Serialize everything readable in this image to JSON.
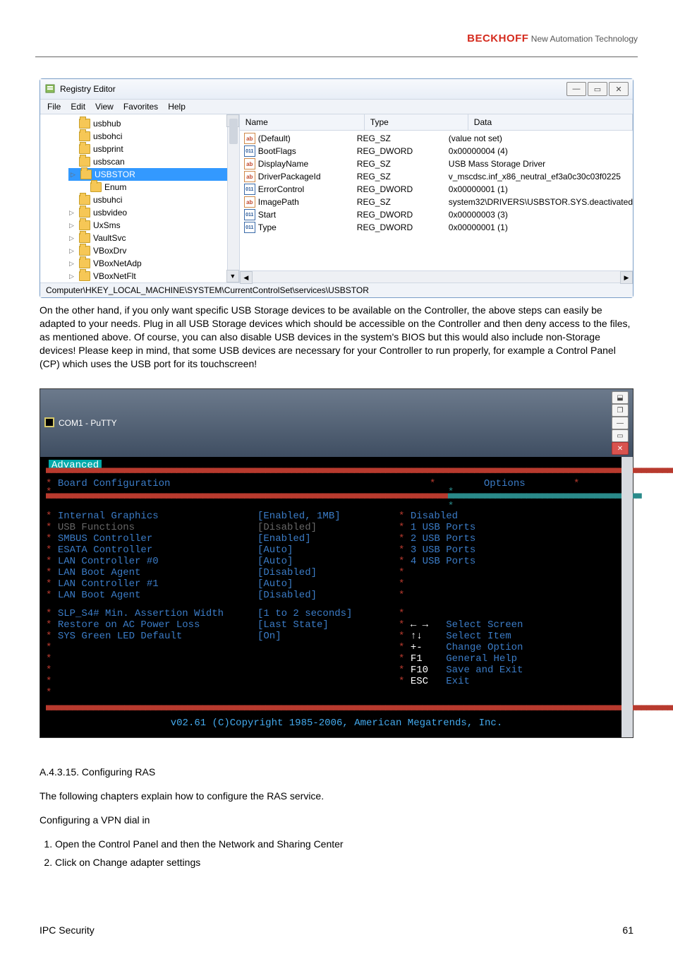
{
  "header": {
    "brand_bold": "BECKHOFF",
    "brand_rest": " New Automation Technology"
  },
  "regedit": {
    "title": "Registry Editor",
    "menus": [
      "File",
      "Edit",
      "View",
      "Favorites",
      "Help"
    ],
    "tree": [
      "usbhub",
      "usbohci",
      "usbprint",
      "usbscan",
      "USBSTOR",
      "Enum",
      "usbuhci",
      "usbvideo",
      "UxSms",
      "VaultSvc",
      "VBoxDrv",
      "VBoxNetAdp",
      "VBoxNetFlt"
    ],
    "selected_index": 4,
    "columns": [
      "Name",
      "Type",
      "Data"
    ],
    "values": [
      {
        "icon": "str",
        "name": "(Default)",
        "type": "REG_SZ",
        "data": "(value not set)"
      },
      {
        "icon": "dw",
        "name": "BootFlags",
        "type": "REG_DWORD",
        "data": "0x00000004 (4)"
      },
      {
        "icon": "str",
        "name": "DisplayName",
        "type": "REG_SZ",
        "data": "USB Mass Storage Driver"
      },
      {
        "icon": "str",
        "name": "DriverPackageId",
        "type": "REG_SZ",
        "data": "v_mscdsc.inf_x86_neutral_ef3a0c30c03f0225"
      },
      {
        "icon": "dw",
        "name": "ErrorControl",
        "type": "REG_DWORD",
        "data": "0x00000001 (1)"
      },
      {
        "icon": "str",
        "name": "ImagePath",
        "type": "REG_SZ",
        "data": "system32\\DRIVERS\\USBSTOR.SYS.deactivated"
      },
      {
        "icon": "dw",
        "name": "Start",
        "type": "REG_DWORD",
        "data": "0x00000003 (3)"
      },
      {
        "icon": "dw",
        "name": "Type",
        "type": "REG_DWORD",
        "data": "0x00000001 (1)"
      }
    ],
    "status": "Computer\\HKEY_LOCAL_MACHINE\\SYSTEM\\CurrentControlSet\\services\\USBSTOR"
  },
  "paragraph1": "On the other hand, if you only want specific USB Storage devices to be available on the Controller, the above steps can easily be adapted to your needs. Plug in all USB Storage devices which should be accessible on the Controller and then deny access to the files, as mentioned above. Of course, you can also disable USB devices in the system's BIOS but this would also include non-Storage devices! Please keep in mind, that some USB devices are necessary for your Controller to run properly, for example a Control Panel (CP) which uses the USB port for its touchscreen!",
  "bios": {
    "window_title": "COM1 - PuTTY",
    "tab_label": "Advanced",
    "section_title": "Board Configuration",
    "options_label": "Options",
    "left_items": [
      {
        "label": "Internal Graphics",
        "val": "[Enabled, 1MB]",
        "lcls": "c-blue",
        "vcls": "c-blue"
      },
      {
        "label": "USB Functions",
        "val": "[Disabled]",
        "lcls": "c-grey",
        "vcls": "c-grey"
      },
      {
        "label": "SMBUS Controller",
        "val": "[Enabled]",
        "lcls": "c-blue",
        "vcls": "c-blue"
      },
      {
        "label": "ESATA Controller",
        "val": "[Auto]",
        "lcls": "c-blue",
        "vcls": "c-blue"
      },
      {
        "label": "LAN Controller #0",
        "val": "[Auto]",
        "lcls": "c-blue",
        "vcls": "c-blue"
      },
      {
        "label": "  LAN Boot Agent",
        "val": "[Disabled]",
        "lcls": "c-blue",
        "vcls": "c-blue"
      },
      {
        "label": "LAN Controller #1",
        "val": "[Auto]",
        "lcls": "c-blue",
        "vcls": "c-blue"
      },
      {
        "label": "  LAN Boot Agent",
        "val": "[Disabled]",
        "lcls": "c-blue",
        "vcls": "c-blue"
      }
    ],
    "left_items2": [
      {
        "label": "SLP_S4# Min. Assertion Width",
        "val": "[1 to 2 seconds]",
        "lcls": "c-blue",
        "vcls": "c-blue"
      },
      {
        "label": "Restore on AC Power Loss",
        "val": "[Last State]",
        "lcls": "c-blue",
        "vcls": "c-blue"
      },
      {
        "label": "SYS Green LED Default",
        "val": "[On]",
        "lcls": "c-blue",
        "vcls": "c-blue"
      }
    ],
    "right_options": [
      "Disabled",
      "1 USB Ports",
      "2 USB Ports",
      "3 USB Ports",
      "4 USB Ports"
    ],
    "help": [
      {
        "k": "← →",
        "v": "Select Screen"
      },
      {
        "k": "↑↓",
        "v": "Select Item"
      },
      {
        "k": "+-",
        "v": "Change Option"
      },
      {
        "k": "F1",
        "v": "General Help"
      },
      {
        "k": "F10",
        "v": "Save and Exit"
      },
      {
        "k": "ESC",
        "v": "Exit"
      }
    ],
    "copyright": "v02.61 (C)Copyright 1985-2006, American Megatrends, Inc."
  },
  "section_heading": "A.4.3.15. Configuring RAS",
  "section_intro": "The following chapters explain how to configure the RAS service.",
  "subheading": "Configuring a VPN dial in",
  "steps": [
    "Open the Control Panel and then the Network and Sharing Center",
    "Click on Change adapter settings"
  ],
  "footer_left": "IPC Security",
  "footer_right": "61"
}
